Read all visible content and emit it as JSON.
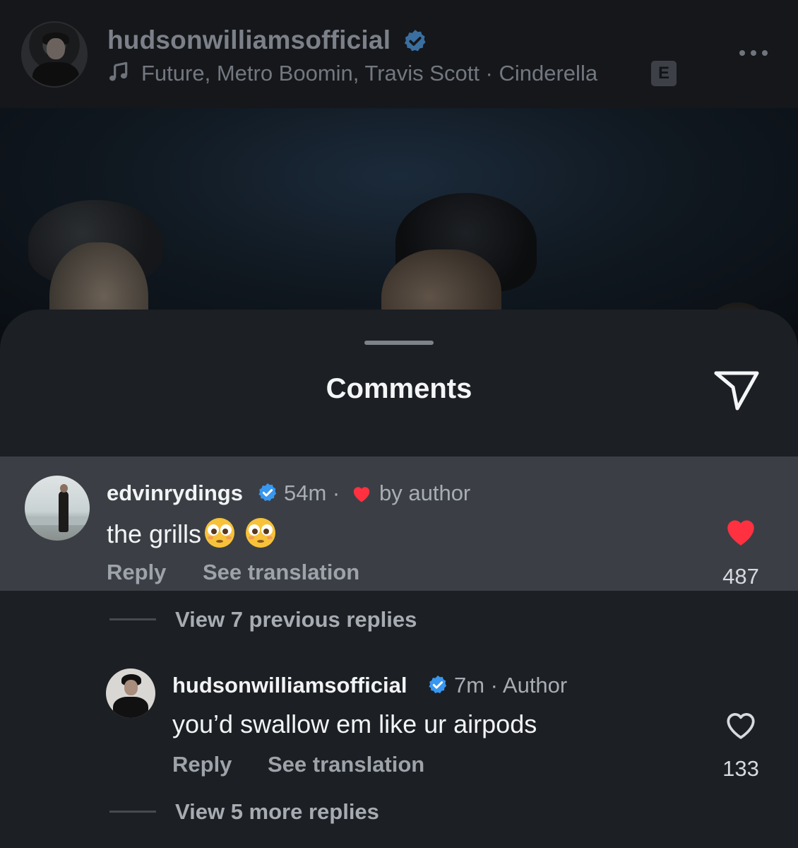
{
  "post": {
    "username": "hudsonwilliamsofficial",
    "music": "Future, Metro Boomin, Travis Scott · Cinderella",
    "explicit_badge": "E"
  },
  "sheet": {
    "title": "Comments"
  },
  "comments": [
    {
      "username": "edvinrydings",
      "time": "54m ·",
      "liked_by_author": "by author",
      "text": "the grills",
      "reply_label": "Reply",
      "translate_label": "See translation",
      "likes": "487",
      "liked": true
    }
  ],
  "replies_previous": "View 7 previous replies",
  "reply": {
    "username": "hudsonwilliamsofficial",
    "time": "7m · Author",
    "text": "you’d swallow em like ur airpods",
    "reply_label": "Reply",
    "translate_label": "See translation",
    "likes": "133",
    "liked": false
  },
  "replies_more": "View 5 more replies",
  "colors": {
    "verified": "#3897f0",
    "heart_liked": "#ff3040",
    "sheet_bg": "#1c1f23",
    "highlight_bg": "#3b3f45"
  },
  "icons": [
    "music-note-icon",
    "verified-icon",
    "more-icon",
    "share-icon",
    "heart-icon",
    "flushed-emoji-icon"
  ]
}
